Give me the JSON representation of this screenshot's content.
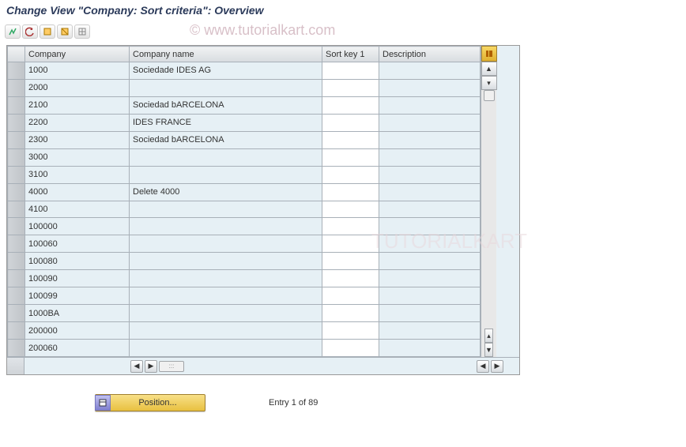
{
  "title": "Change View \"Company: Sort criteria\": Overview",
  "watermark": "© www.tutorialkart.com",
  "watermark2": "TUTORIALKART",
  "columns": {
    "company": "Company",
    "name": "Company name",
    "sortkey": "Sort key 1",
    "desc": "Description"
  },
  "rows": [
    {
      "company": "1000",
      "name": "Sociedade IDES AG",
      "sortkey": "",
      "desc": ""
    },
    {
      "company": "2000",
      "name": "",
      "sortkey": "",
      "desc": ""
    },
    {
      "company": "2100",
      "name": "Sociedad bARCELONA",
      "sortkey": "",
      "desc": ""
    },
    {
      "company": "2200",
      "name": "IDES FRANCE",
      "sortkey": "",
      "desc": ""
    },
    {
      "company": "2300",
      "name": "Sociedad bARCELONA",
      "sortkey": "",
      "desc": ""
    },
    {
      "company": "3000",
      "name": "",
      "sortkey": "",
      "desc": ""
    },
    {
      "company": "3100",
      "name": "",
      "sortkey": "",
      "desc": ""
    },
    {
      "company": "4000",
      "name": "Delete 4000",
      "sortkey": "",
      "desc": ""
    },
    {
      "company": "4100",
      "name": "",
      "sortkey": "",
      "desc": ""
    },
    {
      "company": "100000",
      "name": "",
      "sortkey": "",
      "desc": ""
    },
    {
      "company": "100060",
      "name": "",
      "sortkey": "",
      "desc": ""
    },
    {
      "company": "100080",
      "name": "",
      "sortkey": "",
      "desc": ""
    },
    {
      "company": "100090",
      "name": "",
      "sortkey": "",
      "desc": ""
    },
    {
      "company": "100099",
      "name": "",
      "sortkey": "",
      "desc": ""
    },
    {
      "company": "1000BA",
      "name": "",
      "sortkey": "",
      "desc": ""
    },
    {
      "company": "200000",
      "name": "",
      "sortkey": "",
      "desc": ""
    },
    {
      "company": "200060",
      "name": "",
      "sortkey": "",
      "desc": ""
    }
  ],
  "position_button": "Position...",
  "entry_info": "Entry 1 of 89"
}
